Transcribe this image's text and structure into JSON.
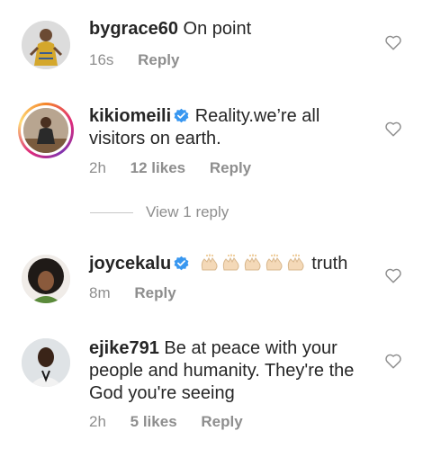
{
  "comments": [
    {
      "username": "bygrace60",
      "text": "On point",
      "time": "16s",
      "likes": "",
      "reply_label": "Reply",
      "verified": false
    },
    {
      "username": "kikiomeili",
      "text": "Reality.we’re all visitors on earth.",
      "time": "2h",
      "likes": "12 likes",
      "reply_label": "Reply",
      "verified": true,
      "story_ring": true
    },
    {
      "username": "joycekalu",
      "text": "truth",
      "emoji": "clapping-hands x5",
      "time": "8m",
      "likes": "",
      "reply_label": "Reply",
      "verified": true
    },
    {
      "username": "ejike791",
      "text": "Be at peace with your people and humanity. They're the God you're seeing",
      "time": "2h",
      "likes": "5 likes",
      "reply_label": "Reply",
      "verified": false
    }
  ],
  "view_replies_label": "View 1 reply",
  "icons": {
    "like": "heart-outline-icon",
    "verified": "verified-badge-icon"
  },
  "colors": {
    "text": "#262626",
    "meta": "#8e8e8e",
    "verified": "#3897f0"
  }
}
